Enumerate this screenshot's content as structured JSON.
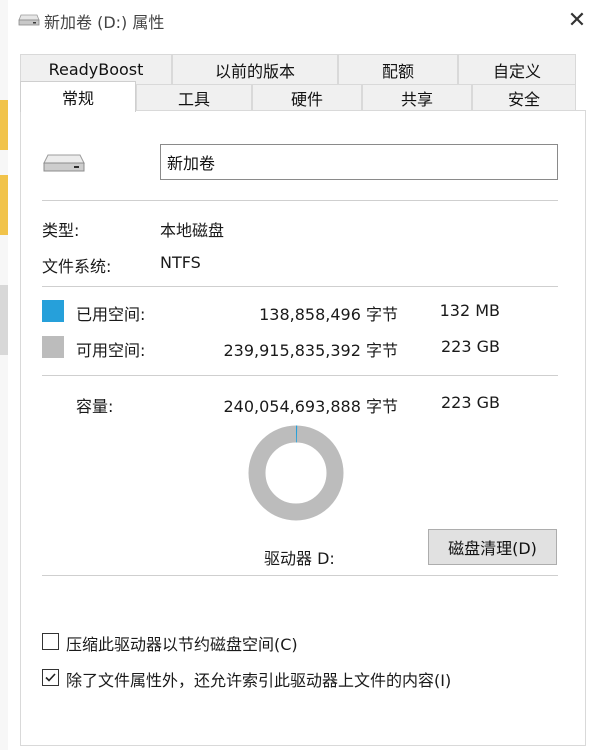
{
  "window": {
    "title": "新加卷 (D:) 属性",
    "close_glyph": "✕"
  },
  "tabs": {
    "row1": [
      "ReadyBoost",
      "以前的版本",
      "配额",
      "自定义"
    ],
    "row2": [
      "常规",
      "工具",
      "硬件",
      "共享",
      "安全"
    ],
    "active": "常规"
  },
  "general": {
    "volume_name": "新加卷",
    "type_label": "类型:",
    "type_value": "本地磁盘",
    "fs_label": "文件系统:",
    "fs_value": "NTFS",
    "used": {
      "label": "已用空间:",
      "bytes": "138,858,496 字节",
      "size": "132 MB",
      "color": "#26a0da"
    },
    "free": {
      "label": "可用空间:",
      "bytes": "239,915,835,392 字节",
      "size": "223 GB",
      "color": "#bcbcbc"
    },
    "capacity": {
      "label": "容量:",
      "bytes": "240,054,693,888 字节",
      "size": "223 GB"
    },
    "drive_label": "驱动器 D:",
    "cleanup_button": "磁盘清理(D)",
    "used_fraction": 0.000578
  },
  "options": {
    "compress": {
      "label": "压缩此驱动器以节约磁盘空间(C)",
      "checked": false
    },
    "index": {
      "label": "除了文件属性外，还允许索引此驱动器上文件的内容(I)",
      "checked": true
    }
  }
}
